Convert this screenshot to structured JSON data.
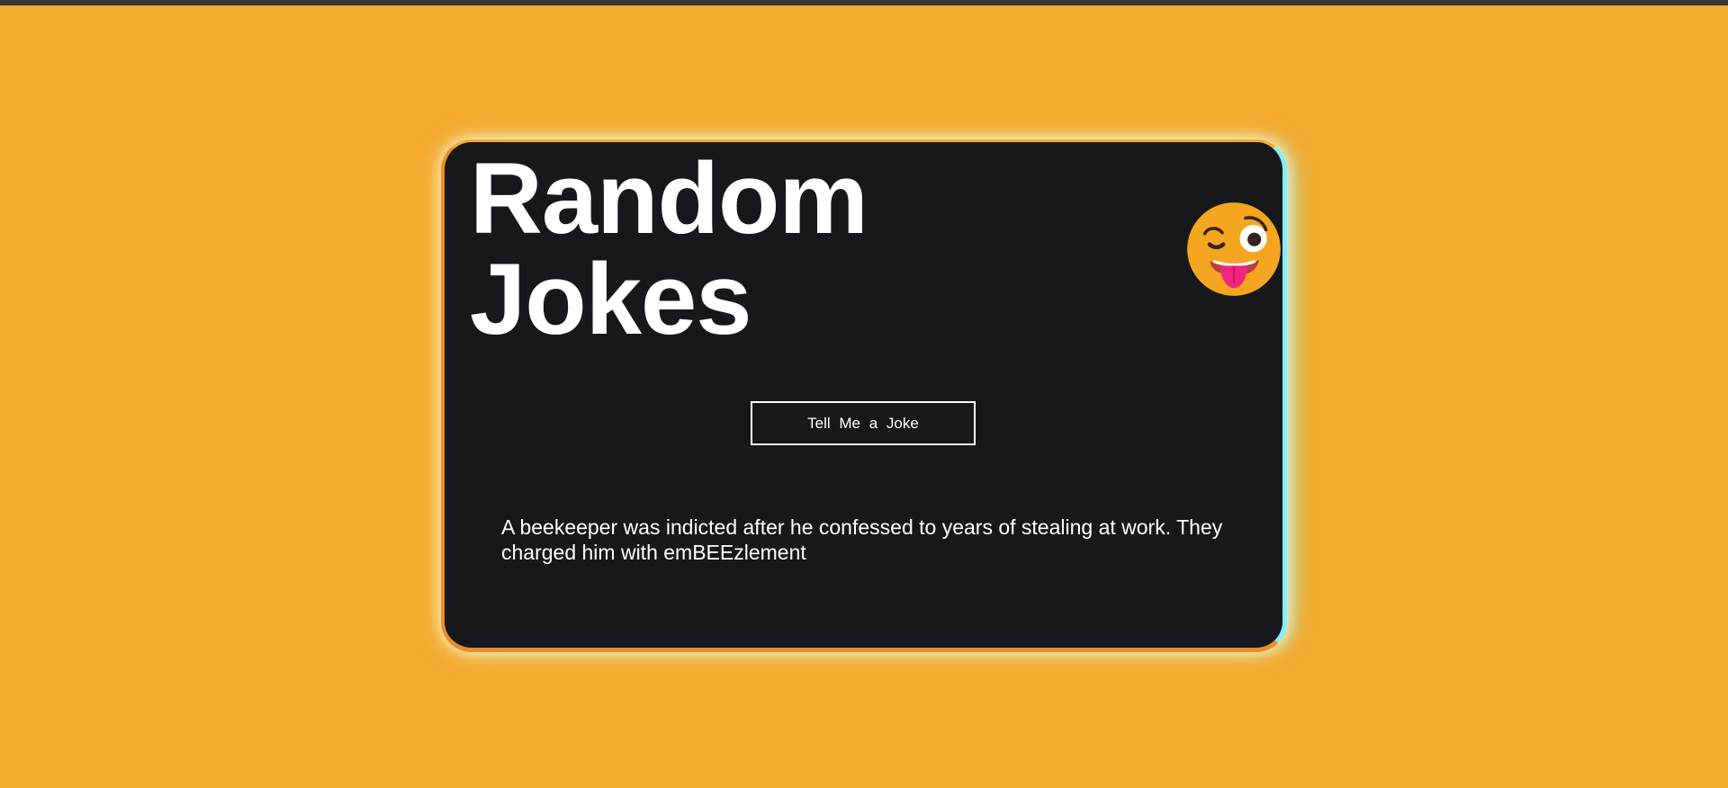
{
  "app": {
    "title": "Random Jokes",
    "emoji": "winking-face-with-tongue-icon"
  },
  "button": {
    "label": "Tell Me a Joke"
  },
  "joke": {
    "text": "A beekeeper was indicted after he confessed to years of stealing at work. They charged him with emBEEzlement"
  },
  "colors": {
    "background": "#f3ac2f",
    "card": "#17181c",
    "text": "#ffffff",
    "glow": "#7ff0ff",
    "tongue": "#f2247d"
  }
}
